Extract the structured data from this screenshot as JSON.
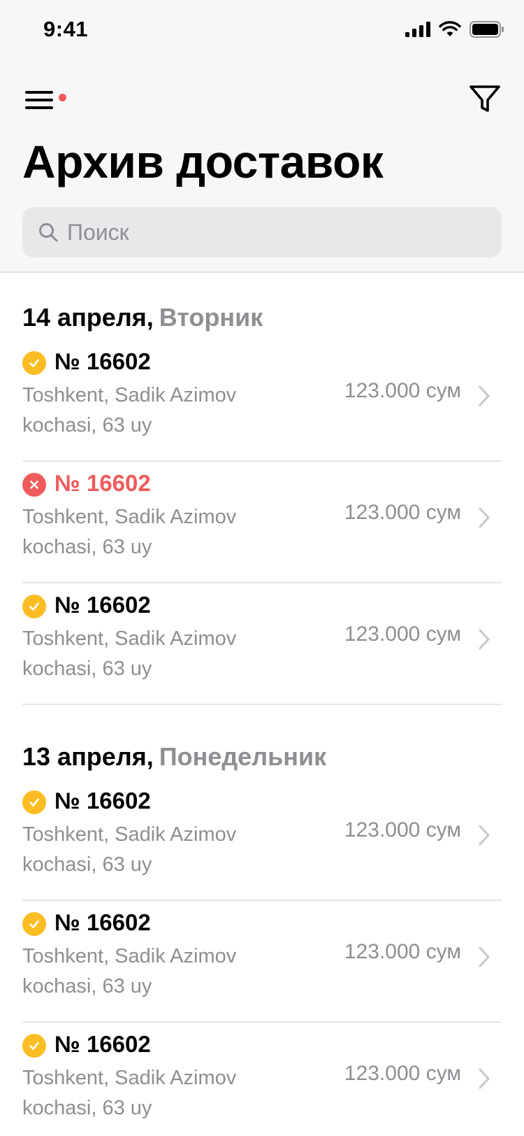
{
  "status_bar": {
    "time": "9:41"
  },
  "header": {
    "title": "Архив доставок",
    "search_placeholder": "Поиск"
  },
  "icons": {
    "menu": "hamburger-menu-icon",
    "filter": "filter-funnel-icon",
    "search": "search-magnifier-icon",
    "delivered": "check-circle-icon",
    "cancelled": "x-circle-icon",
    "chevron": "chevron-right-icon"
  },
  "colors": {
    "accent_yellow": "#fcbd24",
    "cancel_red": "#ef5b5b",
    "secondary_text": "#8e8e93",
    "header_bg": "#f7f7f8"
  },
  "sections": [
    {
      "date": "14 апреля,",
      "weekday": "Вторник",
      "deliveries": [
        {
          "status": "delivered",
          "number": "№ 16602",
          "address": "Toshkent, Sadik Azimov kochasi, 63 uy",
          "price": "123.000 сум"
        },
        {
          "status": "cancelled",
          "number": "№ 16602",
          "address": "Toshkent, Sadik Azimov kochasi, 63 uy",
          "price": "123.000 сум"
        },
        {
          "status": "delivered",
          "number": "№ 16602",
          "address": "Toshkent, Sadik Azimov kochasi, 63 uy",
          "price": "123.000 сум"
        }
      ]
    },
    {
      "date": "13 апреля,",
      "weekday": "Понедельник",
      "deliveries": [
        {
          "status": "delivered",
          "number": "№ 16602",
          "address": "Toshkent, Sadik Azimov kochasi, 63 uy",
          "price": "123.000 сум"
        },
        {
          "status": "delivered",
          "number": "№ 16602",
          "address": "Toshkent, Sadik Azimov kochasi, 63 uy",
          "price": "123.000 сум"
        },
        {
          "status": "delivered",
          "number": "№ 16602",
          "address": "Toshkent, Sadik Azimov kochasi, 63 uy",
          "price": "123.000 сум"
        }
      ]
    }
  ]
}
